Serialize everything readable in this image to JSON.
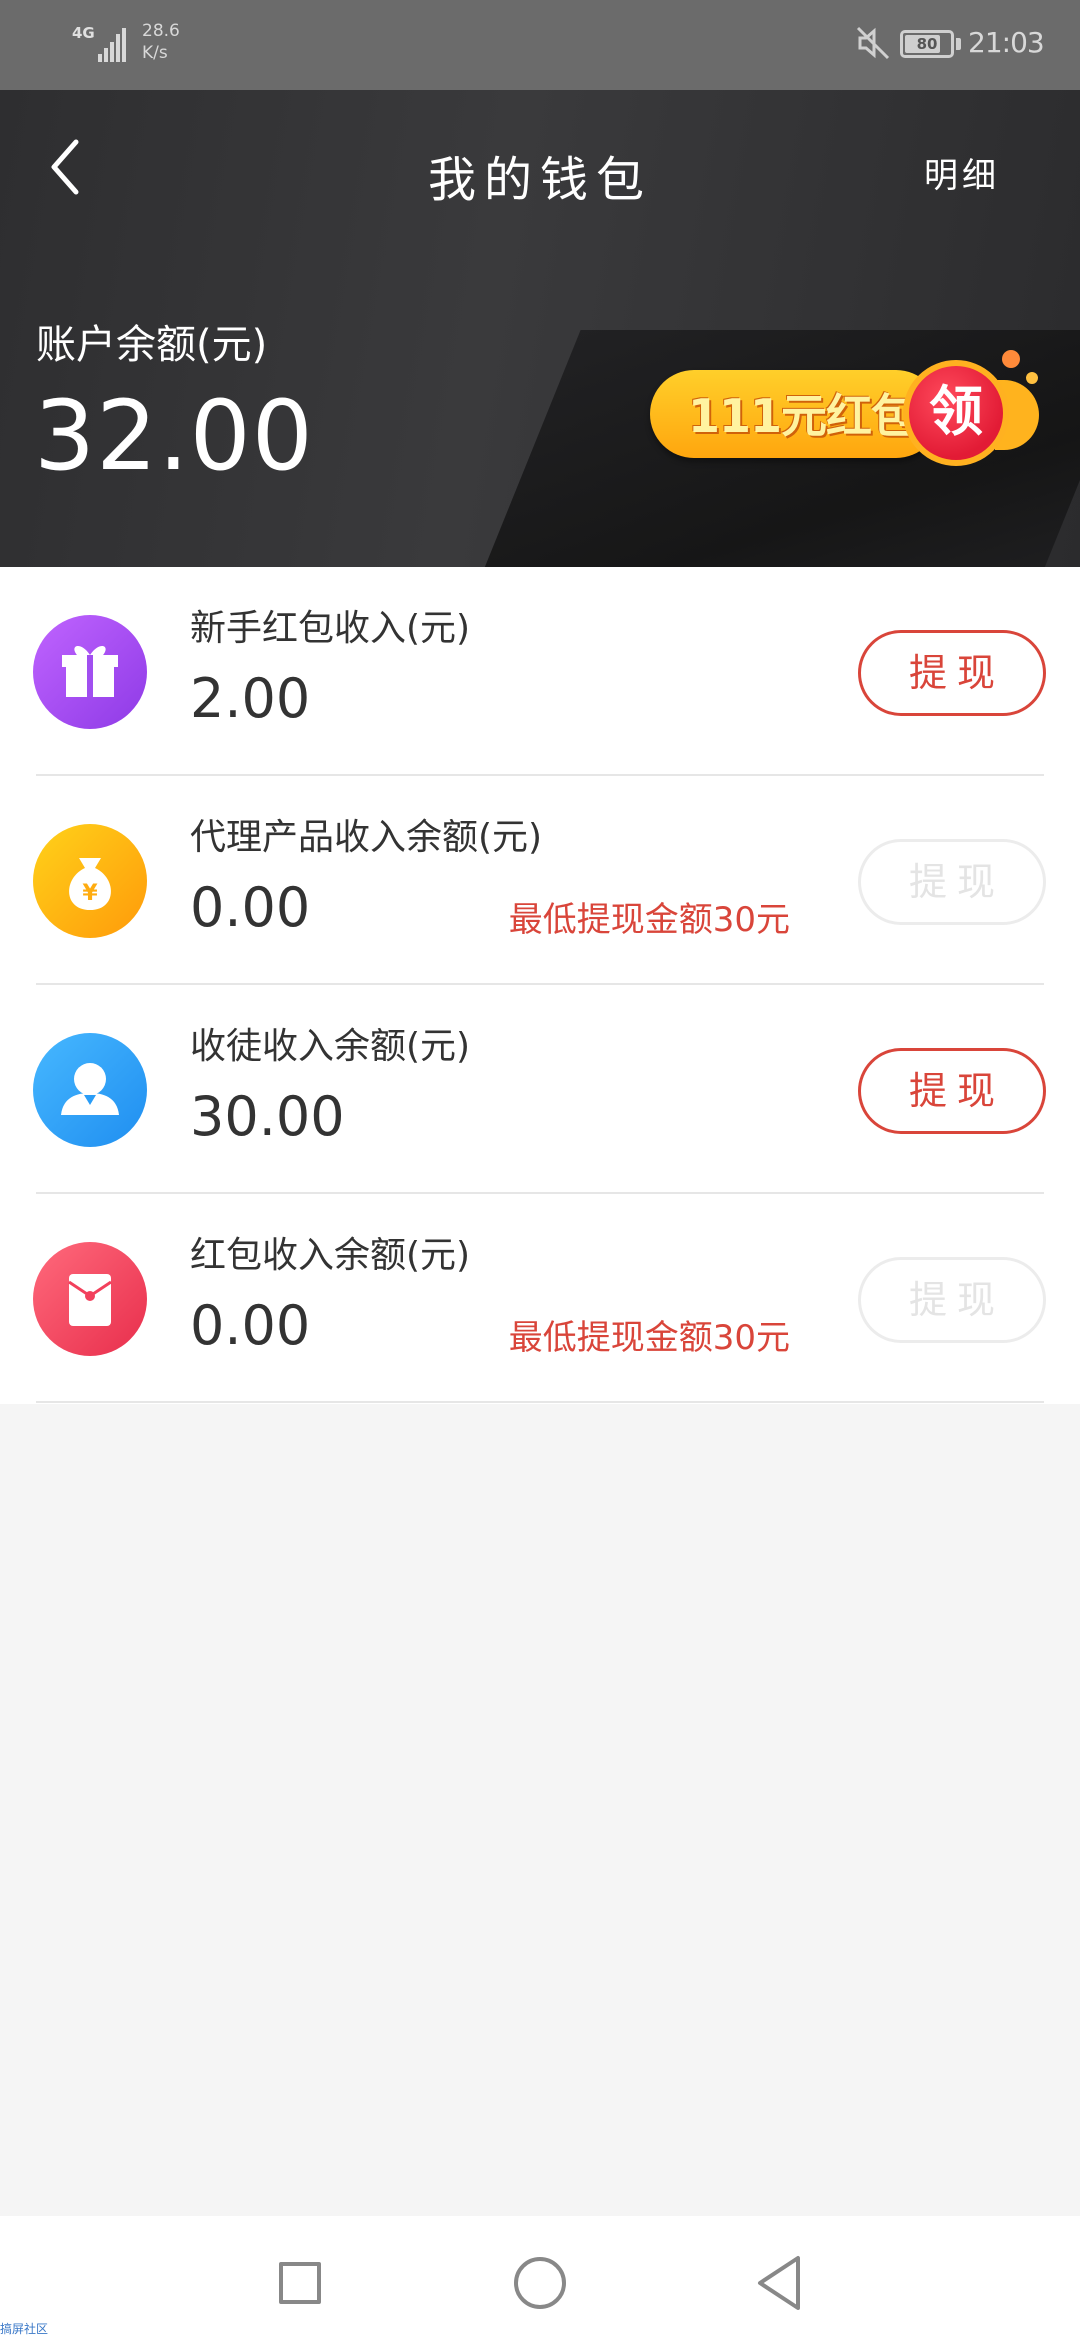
{
  "status_bar": {
    "network": "4G",
    "speed": "28.6",
    "speed_unit": "K/s",
    "battery": "80",
    "battery_level_percent": 80,
    "time": "21:03"
  },
  "header": {
    "title": "我的钱包",
    "detail_link": "明细",
    "balance_label": "账户余额(元)",
    "balance_value": "32.00",
    "redpacket_text": "111元红包",
    "redpacket_action": "领"
  },
  "rows": [
    {
      "label": "新手红包收入(元)",
      "value": "2.00",
      "note": "",
      "button": "提现",
      "button_enabled": true,
      "icon": "gift-icon",
      "icon_color": "#a14ff0"
    },
    {
      "label": "代理产品收入余额(元)",
      "value": "0.00",
      "note": "最低提现金额30元",
      "button": "提现",
      "button_enabled": false,
      "icon": "money-bag-icon",
      "icon_color": "#ffac10"
    },
    {
      "label": "收徒收入余额(元)",
      "value": "30.00",
      "note": "",
      "button": "提现",
      "button_enabled": true,
      "icon": "user-icon",
      "icon_color": "#2a9df7"
    },
    {
      "label": "红包收入余额(元)",
      "value": "0.00",
      "note": "最低提现金额30元",
      "button": "提现",
      "button_enabled": false,
      "icon": "red-envelope-icon",
      "icon_color": "#f2405c"
    }
  ],
  "colors": {
    "accent_red": "#d9453a",
    "disabled_border": "#ececec",
    "header_bg": "#333335"
  },
  "watermark": "搞屏社区"
}
